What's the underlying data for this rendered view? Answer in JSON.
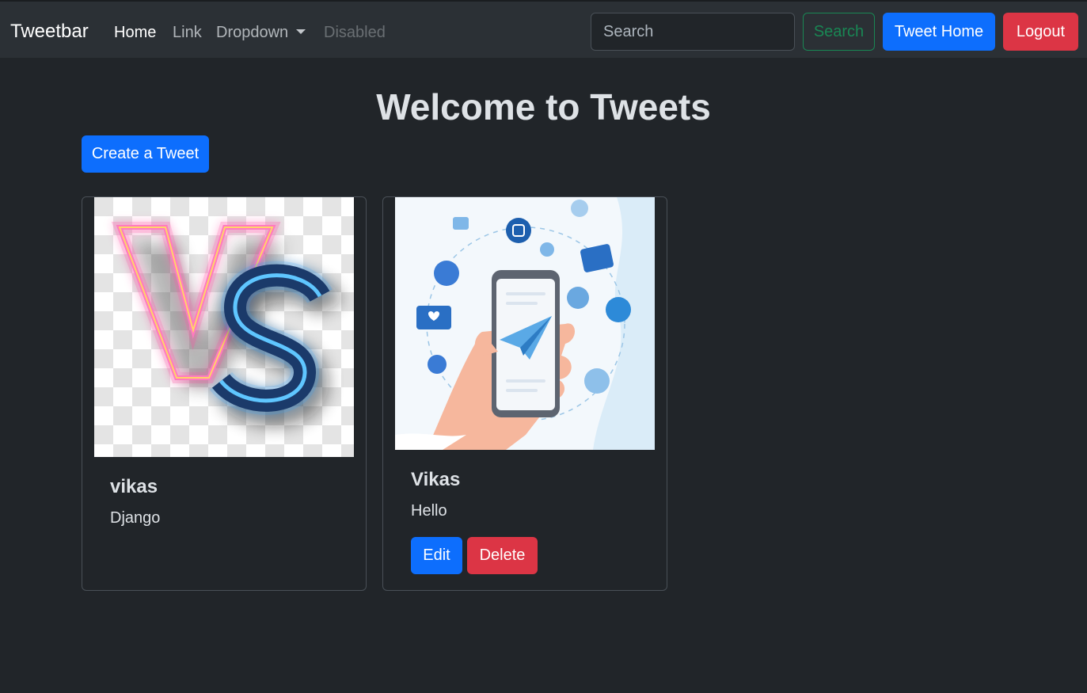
{
  "navbar": {
    "brand": "Tweetbar",
    "links": {
      "home": "Home",
      "link": "Link",
      "dropdown": "Dropdown",
      "disabled": "Disabled"
    },
    "search_placeholder": "Search",
    "search_button": "Search",
    "tweet_home_button": "Tweet Home",
    "logout_button": "Logout"
  },
  "page": {
    "title": "Welcome to Tweets",
    "create_button": "Create a Tweet"
  },
  "tweets": [
    {
      "title": "vikas",
      "text": "Django",
      "image": "vs-neon-image"
    },
    {
      "title": "Vikas",
      "text": "Hello",
      "image": "social-media-phone-image",
      "edit_label": "Edit",
      "delete_label": "Delete"
    }
  ],
  "colors": {
    "background": "#212529",
    "navbar": "#2b3035",
    "primary": "#0d6efd",
    "danger": "#dc3545",
    "success": "#198754"
  }
}
